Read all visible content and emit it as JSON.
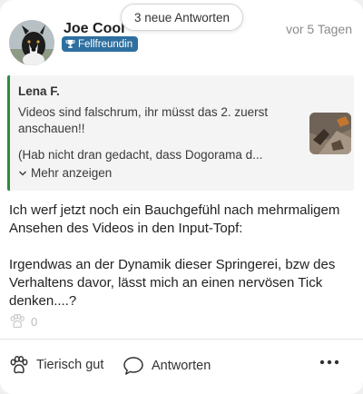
{
  "banner": {
    "new_replies": "3 neue Antworten"
  },
  "post": {
    "author": "Joe Cool",
    "badge": "Fellfreundin",
    "timestamp": "vor 5 Tagen",
    "quote": {
      "author": "Lena F.",
      "text_line1": "Videos sind falschrum, ihr müsst das 2. zuerst anschauen!!",
      "text_line2": "(Hab nicht dran gedacht, dass Dogorama d...",
      "more_label": "Mehr anzeigen"
    },
    "body": {
      "paragraph1": "Ich werf jetzt noch ein Bauchgefühl nach mehrmaligem Ansehen des Videos in den Input-Topf:",
      "paragraph2": "Irgendwas an der Dynamik dieser Springerei, bzw des Verhaltens davor, lässt mich an einen nervösen Tick denken....?"
    },
    "reactions": {
      "count": "0",
      "icon": "paw-icon"
    }
  },
  "actions": {
    "like_label": "Tierisch gut",
    "reply_label": "Antworten",
    "more_icon": "more-horizontal-icon"
  },
  "colors": {
    "badge": "#2e6fa0",
    "quote_accent": "#2e8b3e",
    "muted": "#8a8a8a"
  }
}
